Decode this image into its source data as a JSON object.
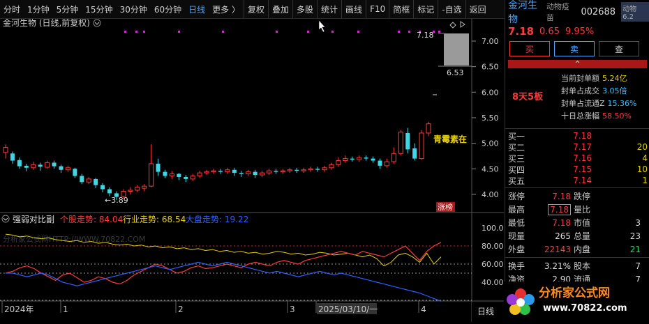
{
  "toolbar": {
    "periods": [
      "分时",
      "1分钟",
      "5分钟",
      "15分钟",
      "30分钟",
      "60分钟",
      "日线",
      "更多 〉"
    ],
    "active_period": "日线",
    "actions": [
      "复权",
      "叠加",
      "多股",
      "统计",
      "画线",
      "F10",
      "简框",
      "标记",
      "-自选",
      "返回"
    ]
  },
  "main_chart": {
    "title": "金河生物 (日线,前复权)",
    "y_ticks": [
      "7.00",
      "6.50",
      "6.00",
      "5.50",
      "5.00",
      "4.50",
      "4.00"
    ],
    "high_label": "7.18",
    "low_label": "6.53",
    "min_marker": "←3.89",
    "annotation": "青霉素在",
    "limit_tag": "涨榜"
  },
  "indicator": {
    "name": "强弱对比副",
    "items": [
      {
        "label": "个股走势:",
        "value": "84.04",
        "color": "#ff3a3a"
      },
      {
        "label": "行业走势:",
        "value": "68.54",
        "color": "#e8d000"
      },
      {
        "label": "大盘走势:",
        "value": "19.22",
        "color": "#3060ff"
      }
    ],
    "y_ticks": [
      "100.00",
      "80.00",
      "60.00",
      "40.00"
    ],
    "watermark": "分析家公式网HTTP://WWW.70822.COM"
  },
  "x_axis": {
    "labels": [
      "2024年",
      "1",
      "2",
      "3",
      "2025/03/10/一",
      "4"
    ],
    "period_btn": "日线"
  },
  "panel": {
    "name": "金河生物",
    "category": "动物疫苗",
    "code": "002688",
    "badge": "动物 6.2",
    "price": "7.18",
    "change": "0.65",
    "pct": "9.95%",
    "buttons": [
      "买",
      "卖",
      "查"
    ],
    "collapse": "^",
    "board_tag": "8天5板",
    "stats": [
      {
        "label": "当前封单额",
        "value": "5.24亿",
        "cls": "vy"
      },
      {
        "label": "封单占成交",
        "value": "3.05倍",
        "cls": "vc"
      },
      {
        "label": "封单占流通Z",
        "value": "15.36%",
        "cls": "vc"
      },
      {
        "label": "十日总涨幅",
        "value": "58.50%",
        "cls": "v"
      }
    ],
    "bids": [
      {
        "k": "买一",
        "p": "7.18",
        "q": ""
      },
      {
        "k": "买二",
        "p": "7.17",
        "q": "20"
      },
      {
        "k": "买三",
        "p": "7.16",
        "q": "4"
      },
      {
        "k": "买四",
        "p": "7.15",
        "q": "10"
      },
      {
        "k": "买五",
        "p": "7.14",
        "q": "1"
      }
    ],
    "quote": [
      {
        "k": "涨停",
        "v": "7.18",
        "vc": "red",
        "k2": "跌停",
        "v2": ""
      },
      {
        "k": "最高",
        "v": "7.18",
        "vc": "red box",
        "k2": "量比",
        "v2": ""
      },
      {
        "k": "最低",
        "v": "7.18",
        "vc": "red",
        "k2": "市值",
        "v2": "3"
      },
      {
        "k": "现量",
        "v": "265",
        "vc": "wht",
        "k2": "总量",
        "v2": "23"
      },
      {
        "k": "外盘",
        "v": "22143",
        "vc": "red",
        "k2": "内盘",
        "v2": "21"
      }
    ],
    "quote2": [
      {
        "k": "换手",
        "v": "3.21%",
        "k2": "股本",
        "v2": "7"
      },
      {
        "k": "净资",
        "v": "2.90",
        "k2": "流通",
        "v2": "7"
      }
    ]
  },
  "logo": {
    "text1": "分析家公式网",
    "text2": "www.70822.com"
  },
  "colors": {
    "up": "#ff3a3a",
    "down": "#3fd6e6",
    "ma_yellow": "#e8d000",
    "ma_blue": "#3060ff",
    "accent": "#4aa3ff"
  },
  "candles": [
    [
      4.82,
      4.92,
      4.7,
      4.98
    ],
    [
      4.8,
      4.66,
      4.6,
      4.84
    ],
    [
      4.67,
      4.55,
      4.5,
      4.72
    ],
    [
      4.56,
      4.52,
      4.45,
      4.6
    ],
    [
      4.52,
      4.58,
      4.48,
      4.64
    ],
    [
      4.58,
      4.54,
      4.46,
      4.62
    ],
    [
      4.53,
      4.62,
      4.5,
      4.66
    ],
    [
      4.62,
      4.55,
      4.5,
      4.66
    ],
    [
      4.55,
      4.48,
      4.42,
      4.58
    ],
    [
      4.48,
      4.52,
      4.44,
      4.56
    ],
    [
      4.5,
      4.36,
      4.32,
      4.52
    ],
    [
      4.36,
      4.24,
      4.2,
      4.4
    ],
    [
      4.24,
      4.3,
      4.2,
      4.34
    ],
    [
      4.3,
      4.18,
      4.12,
      4.32
    ],
    [
      4.18,
      4.1,
      4.04,
      4.22
    ],
    [
      4.1,
      4.02,
      3.96,
      4.14
    ],
    [
      4.02,
      3.95,
      3.89,
      4.06
    ],
    [
      3.96,
      4.06,
      3.92,
      4.1
    ],
    [
      4.06,
      4.08,
      4.0,
      4.14
    ],
    [
      4.08,
      4.14,
      4.04,
      4.18
    ],
    [
      4.12,
      4.16,
      4.06,
      4.2
    ],
    [
      4.16,
      4.6,
      4.14,
      4.98
    ],
    [
      4.6,
      4.44,
      4.36,
      4.7
    ],
    [
      4.44,
      4.36,
      4.32,
      4.48
    ],
    [
      4.36,
      4.4,
      4.3,
      4.46
    ],
    [
      4.4,
      4.34,
      4.28,
      4.42
    ],
    [
      4.34,
      4.3,
      4.24,
      4.38
    ],
    [
      4.3,
      4.36,
      4.26,
      4.4
    ],
    [
      4.36,
      4.42,
      4.32,
      4.46
    ],
    [
      4.42,
      4.44,
      4.38,
      4.48
    ],
    [
      4.44,
      4.46,
      4.4,
      4.5
    ],
    [
      4.46,
      4.44,
      4.4,
      4.5
    ],
    [
      4.44,
      4.48,
      4.4,
      4.52
    ],
    [
      4.48,
      4.42,
      4.36,
      4.52
    ],
    [
      4.42,
      4.4,
      4.34,
      4.46
    ],
    [
      4.4,
      4.44,
      4.36,
      4.48
    ],
    [
      4.44,
      4.38,
      4.32,
      4.48
    ],
    [
      4.38,
      4.42,
      4.34,
      4.46
    ],
    [
      4.42,
      4.46,
      4.38,
      4.5
    ],
    [
      4.46,
      4.44,
      4.4,
      4.5
    ],
    [
      4.44,
      4.46,
      4.4,
      4.5
    ],
    [
      4.46,
      4.48,
      4.42,
      4.52
    ],
    [
      4.48,
      4.46,
      4.42,
      4.52
    ],
    [
      4.46,
      4.48,
      4.42,
      4.52
    ],
    [
      4.48,
      4.5,
      4.44,
      4.54
    ],
    [
      4.5,
      4.48,
      4.44,
      4.54
    ],
    [
      4.48,
      4.52,
      4.44,
      4.56
    ],
    [
      4.52,
      4.58,
      4.48,
      4.62
    ],
    [
      4.58,
      4.66,
      4.54,
      4.72
    ],
    [
      4.66,
      4.7,
      4.62,
      4.76
    ],
    [
      4.7,
      4.68,
      4.64,
      4.74
    ],
    [
      4.68,
      4.72,
      4.64,
      4.76
    ],
    [
      4.72,
      4.7,
      4.66,
      4.76
    ],
    [
      4.7,
      4.66,
      4.62,
      4.74
    ],
    [
      4.66,
      4.56,
      4.5,
      4.7
    ],
    [
      4.56,
      4.64,
      4.52,
      4.7
    ],
    [
      4.64,
      4.8,
      4.6,
      4.92
    ],
    [
      4.8,
      5.22,
      4.76,
      5.26
    ],
    [
      5.2,
      4.88,
      4.8,
      5.3
    ],
    [
      4.9,
      4.7,
      4.66,
      5.0
    ],
    [
      4.7,
      5.2,
      4.68,
      5.26
    ],
    [
      5.2,
      5.38,
      5.14,
      5.42
    ]
  ]
}
